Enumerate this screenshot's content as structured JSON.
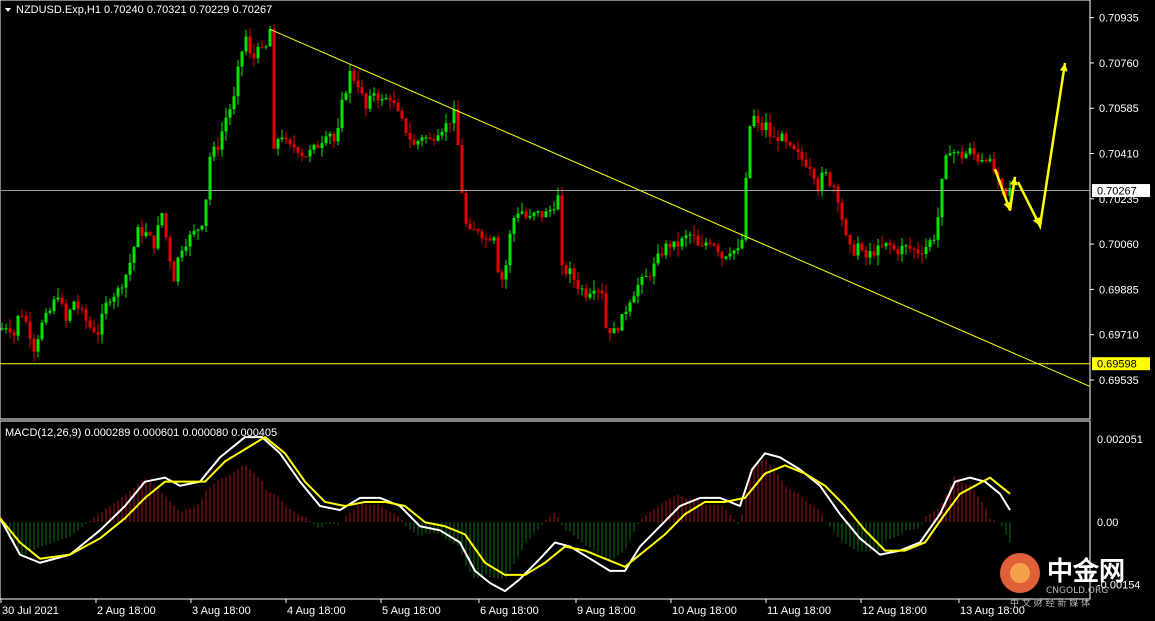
{
  "header": {
    "symbol_line": "NZDUSD.Exp,H1  0.70240 0.70321 0.70229 0.70267"
  },
  "macd_header": "MACD(12,26,9) 0.000289 0.000601 0.000080 0.000405",
  "price_tags": {
    "current": "0.70267",
    "support": "0.69598"
  },
  "watermark": {
    "brand": "中金网",
    "tagline": "中 文 财 经 新 媒 体",
    "domain": "CNGOLD.ORG"
  },
  "colors": {
    "background": "#000000",
    "bull": "#00e600",
    "bear": "#e60000",
    "trendline": "#ffff00",
    "macd_line": "#ffffff",
    "signal_line": "#ffff00",
    "support_tag": "#ffff00",
    "current_tag": "#ffffff"
  },
  "chart_data": [
    {
      "type": "candlestick",
      "name": "NZDUSD.Exp,H1",
      "ylim": [
        0.6945,
        0.7098
      ],
      "y_ticks": [
        "0.70935",
        "0.70760",
        "0.70585",
        "0.70410",
        "0.70235",
        "0.70060",
        "0.69885",
        "0.69710",
        "0.69535"
      ],
      "x_ticks": [
        "30 Jul 2021",
        "2 Aug 18:00",
        "3 Aug 18:00",
        "4 Aug 18:00",
        "5 Aug 18:00",
        "6 Aug 18:00",
        "9 Aug 18:00",
        "10 Aug 18:00",
        "11 Aug 18:00",
        "12 Aug 18:00",
        "13 Aug 18:00"
      ],
      "close_path": [
        [
          0,
          0.6973
        ],
        [
          8,
          0.6975
        ],
        [
          14,
          0.6971
        ],
        [
          20,
          0.6981
        ],
        [
          28,
          0.6974
        ],
        [
          34,
          0.6966
        ],
        [
          42,
          0.6975
        ],
        [
          50,
          0.698
        ],
        [
          58,
          0.6987
        ],
        [
          66,
          0.6976
        ],
        [
          74,
          0.6984
        ],
        [
          82,
          0.6979
        ],
        [
          90,
          0.6974
        ],
        [
          98,
          0.6972
        ],
        [
          108,
          0.6985
        ],
        [
          118,
          0.6988
        ],
        [
          128,
          0.6996
        ],
        [
          138,
          0.7011
        ],
        [
          146,
          0.701
        ],
        [
          154,
          0.7006
        ],
        [
          162,
          0.7018
        ],
        [
          168,
          0.7004
        ],
        [
          174,
          0.6993
        ],
        [
          180,
          0.7004
        ],
        [
          188,
          0.7008
        ],
        [
          196,
          0.7011
        ],
        [
          204,
          0.7016
        ],
        [
          210,
          0.704
        ],
        [
          218,
          0.7044
        ],
        [
          226,
          0.7055
        ],
        [
          234,
          0.7062
        ],
        [
          240,
          0.7078
        ],
        [
          246,
          0.7086
        ],
        [
          252,
          0.7075
        ],
        [
          258,
          0.7084
        ],
        [
          264,
          0.7078
        ],
        [
          270,
          0.7089
        ],
        [
          274,
          0.7041
        ],
        [
          280,
          0.705
        ],
        [
          288,
          0.7043
        ],
        [
          296,
          0.7044
        ],
        [
          304,
          0.704
        ],
        [
          312,
          0.7042
        ],
        [
          320,
          0.7045
        ],
        [
          328,
          0.7051
        ],
        [
          336,
          0.7044
        ],
        [
          342,
          0.706
        ],
        [
          350,
          0.7072
        ],
        [
          358,
          0.7068
        ],
        [
          366,
          0.7058
        ],
        [
          374,
          0.7065
        ],
        [
          382,
          0.7061
        ],
        [
          390,
          0.7063
        ],
        [
          398,
          0.7056
        ],
        [
          406,
          0.705
        ],
        [
          414,
          0.7044
        ],
        [
          422,
          0.7048
        ],
        [
          430,
          0.7046
        ],
        [
          438,
          0.705
        ],
        [
          446,
          0.7052
        ],
        [
          454,
          0.7056
        ],
        [
          460,
          0.7038
        ],
        [
          464,
          0.7015
        ],
        [
          470,
          0.701
        ],
        [
          478,
          0.7012
        ],
        [
          486,
          0.7008
        ],
        [
          494,
          0.701
        ],
        [
          500,
          0.699
        ],
        [
          506,
          0.6998
        ],
        [
          512,
          0.7015
        ],
        [
          520,
          0.702
        ],
        [
          528,
          0.7015
        ],
        [
          536,
          0.7018
        ],
        [
          544,
          0.7017
        ],
        [
          552,
          0.702
        ],
        [
          558,
          0.7024
        ],
        [
          562,
          0.6996
        ],
        [
          570,
          0.6995
        ],
        [
          578,
          0.699
        ],
        [
          586,
          0.6987
        ],
        [
          594,
          0.699
        ],
        [
          602,
          0.6988
        ],
        [
          606,
          0.6974
        ],
        [
          614,
          0.6972
        ],
        [
          622,
          0.6977
        ],
        [
          630,
          0.6985
        ],
        [
          638,
          0.699
        ],
        [
          646,
          0.6993
        ],
        [
          652,
          0.6996
        ],
        [
          660,
          0.7002
        ],
        [
          668,
          0.7006
        ],
        [
          676,
          0.7005
        ],
        [
          684,
          0.7008
        ],
        [
          692,
          0.701
        ],
        [
          700,
          0.7003
        ],
        [
          708,
          0.7008
        ],
        [
          716,
          0.7006
        ],
        [
          722,
          0.7001
        ],
        [
          730,
          0.7004
        ],
        [
          738,
          0.7003
        ],
        [
          744,
          0.701
        ],
        [
          748,
          0.705
        ],
        [
          754,
          0.7055
        ],
        [
          760,
          0.705
        ],
        [
          766,
          0.7052
        ],
        [
          772,
          0.7046
        ],
        [
          780,
          0.7048
        ],
        [
          788,
          0.7043
        ],
        [
          796,
          0.7041
        ],
        [
          804,
          0.7038
        ],
        [
          812,
          0.7036
        ],
        [
          818,
          0.7028
        ],
        [
          824,
          0.7034
        ],
        [
          830,
          0.703
        ],
        [
          836,
          0.7028
        ],
        [
          840,
          0.702
        ],
        [
          846,
          0.7008
        ],
        [
          852,
          0.7002
        ],
        [
          858,
          0.7006
        ],
        [
          864,
          0.7
        ],
        [
          872,
          0.7003
        ],
        [
          880,
          0.7004
        ],
        [
          888,
          0.7006
        ],
        [
          896,
          0.7003
        ],
        [
          904,
          0.7005
        ],
        [
          912,
          0.7004
        ],
        [
          920,
          0.7003
        ],
        [
          928,
          0.7006
        ],
        [
          936,
          0.701
        ],
        [
          944,
          0.7036
        ],
        [
          950,
          0.7043
        ],
        [
          956,
          0.7041
        ],
        [
          962,
          0.704
        ],
        [
          970,
          0.7042
        ],
        [
          978,
          0.7039
        ],
        [
          986,
          0.704
        ],
        [
          994,
          0.7034
        ],
        [
          1000,
          0.7027
        ],
        [
          1006,
          0.7024
        ],
        [
          1010,
          0.7027
        ]
      ],
      "trendline": {
        "from": [
          270,
          0.7089
        ],
        "to": [
          1090,
          0.6951
        ]
      },
      "horizontal_lines": [
        0.70267,
        0.69598
      ],
      "forecast_arrows": [
        {
          "from": [
            995,
            0.7035
          ],
          "to": [
            1010,
            0.7019
          ],
          "to2": [
            1015,
            0.7032
          ]
        },
        {
          "from": [
            1018,
            0.703
          ],
          "to": [
            1040,
            0.7013
          ],
          "to2": [
            1065,
            0.7076
          ]
        }
      ]
    },
    {
      "type": "macd",
      "name": "MACD(12,26,9)",
      "ylim": [
        -0.00182,
        0.00225
      ],
      "y_ticks": [
        "0.002051",
        "0.00",
        "-0.00154"
      ],
      "macd_path": [
        [
          0,
          0.0001
        ],
        [
          20,
          -0.0008
        ],
        [
          40,
          -0.001
        ],
        [
          70,
          -0.0008
        ],
        [
          100,
          -0.0002
        ],
        [
          125,
          0.0004
        ],
        [
          145,
          0.001
        ],
        [
          165,
          0.0011
        ],
        [
          180,
          0.0009
        ],
        [
          200,
          0.001
        ],
        [
          220,
          0.0016
        ],
        [
          245,
          0.0021
        ],
        [
          262,
          0.0021
        ],
        [
          280,
          0.0017
        ],
        [
          300,
          0.001
        ],
        [
          320,
          0.0004
        ],
        [
          340,
          0.0003
        ],
        [
          360,
          0.0006
        ],
        [
          380,
          0.0006
        ],
        [
          400,
          0.0004
        ],
        [
          420,
          -0.0001
        ],
        [
          440,
          -0.0002
        ],
        [
          460,
          -0.0005
        ],
        [
          475,
          -0.0012
        ],
        [
          490,
          -0.0015
        ],
        [
          505,
          -0.0017
        ],
        [
          520,
          -0.0014
        ],
        [
          540,
          -0.0009
        ],
        [
          555,
          -0.0005
        ],
        [
          570,
          -0.0006
        ],
        [
          590,
          -0.0009
        ],
        [
          610,
          -0.0012
        ],
        [
          625,
          -0.0012
        ],
        [
          640,
          -0.0006
        ],
        [
          660,
          -0.0001
        ],
        [
          680,
          0.0004
        ],
        [
          700,
          0.0006
        ],
        [
          720,
          0.0006
        ],
        [
          740,
          0.0004
        ],
        [
          752,
          0.0013
        ],
        [
          765,
          0.0017
        ],
        [
          780,
          0.0016
        ],
        [
          800,
          0.0013
        ],
        [
          820,
          0.0009
        ],
        [
          840,
          0.0002
        ],
        [
          860,
          -0.0004
        ],
        [
          880,
          -0.0008
        ],
        [
          900,
          -0.0007
        ],
        [
          920,
          -0.0005
        ],
        [
          940,
          0.0002
        ],
        [
          955,
          0.001
        ],
        [
          970,
          0.0011
        ],
        [
          985,
          0.001
        ],
        [
          1000,
          0.0007
        ],
        [
          1010,
          0.0003
        ]
      ],
      "signal_path": [
        [
          0,
          0.0001
        ],
        [
          20,
          -0.0005
        ],
        [
          40,
          -0.0009
        ],
        [
          70,
          -0.0008
        ],
        [
          100,
          -0.0004
        ],
        [
          125,
          0.0001
        ],
        [
          145,
          0.0006
        ],
        [
          165,
          0.001
        ],
        [
          185,
          0.001
        ],
        [
          205,
          0.001
        ],
        [
          225,
          0.0015
        ],
        [
          245,
          0.0018
        ],
        [
          265,
          0.0021
        ],
        [
          285,
          0.0017
        ],
        [
          305,
          0.001
        ],
        [
          325,
          0.0005
        ],
        [
          345,
          0.0004
        ],
        [
          365,
          0.0005
        ],
        [
          385,
          0.0005
        ],
        [
          405,
          0.0004
        ],
        [
          425,
          0.0
        ],
        [
          445,
          -0.0001
        ],
        [
          465,
          -0.0003
        ],
        [
          485,
          -0.001
        ],
        [
          505,
          -0.0013
        ],
        [
          525,
          -0.0013
        ],
        [
          545,
          -0.001
        ],
        [
          565,
          -0.0006
        ],
        [
          585,
          -0.0007
        ],
        [
          605,
          -0.0009
        ],
        [
          625,
          -0.0011
        ],
        [
          645,
          -0.0007
        ],
        [
          665,
          -0.0003
        ],
        [
          685,
          0.0002
        ],
        [
          705,
          0.0005
        ],
        [
          725,
          0.0005
        ],
        [
          745,
          0.0006
        ],
        [
          765,
          0.0012
        ],
        [
          785,
          0.0014
        ],
        [
          805,
          0.0012
        ],
        [
          825,
          0.0009
        ],
        [
          845,
          0.0004
        ],
        [
          865,
          -0.0002
        ],
        [
          885,
          -0.0007
        ],
        [
          905,
          -0.0007
        ],
        [
          925,
          -0.0005
        ],
        [
          945,
          0.0002
        ],
        [
          960,
          0.0007
        ],
        [
          975,
          0.0009
        ],
        [
          990,
          0.0011
        ],
        [
          1010,
          0.0007
        ]
      ]
    }
  ]
}
